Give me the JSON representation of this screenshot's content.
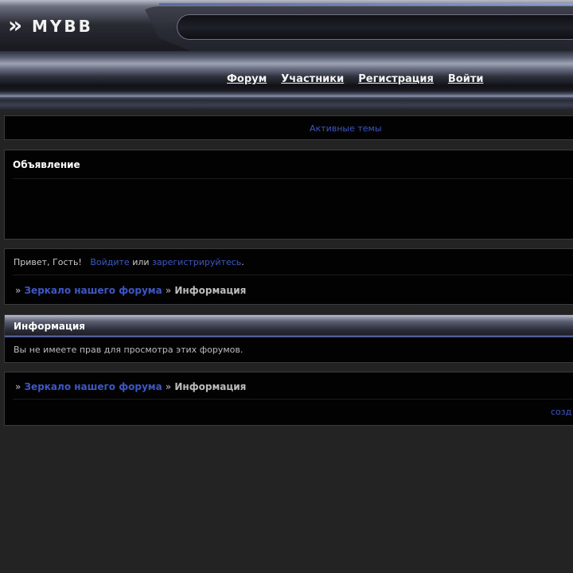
{
  "header": {
    "logo_arrow": "»",
    "logo_text": "MYBB"
  },
  "nav": {
    "items": [
      {
        "label": "Форум"
      },
      {
        "label": "Участники"
      },
      {
        "label": "Регистрация"
      },
      {
        "label": "Войти"
      }
    ]
  },
  "menu": {
    "active_topics": "Активные темы"
  },
  "announcement": {
    "title": "Объявление"
  },
  "welcome": {
    "greeting": "Привет, Гость!",
    "login_link": "Войдите",
    "or_text": "или",
    "register_link": "зарегистрируйтесь",
    "period": "."
  },
  "breadcrumbs": {
    "separator": "»",
    "forum_link": "Зеркало нашего форума",
    "current": "Информация"
  },
  "info": {
    "title": "Информация",
    "message": "Вы не имеете прав для просмотра этих форумов."
  },
  "footer": {
    "credit_link": "созд"
  },
  "colors": {
    "link": "#3d57c4",
    "background": "#232323",
    "block": "#020202"
  }
}
